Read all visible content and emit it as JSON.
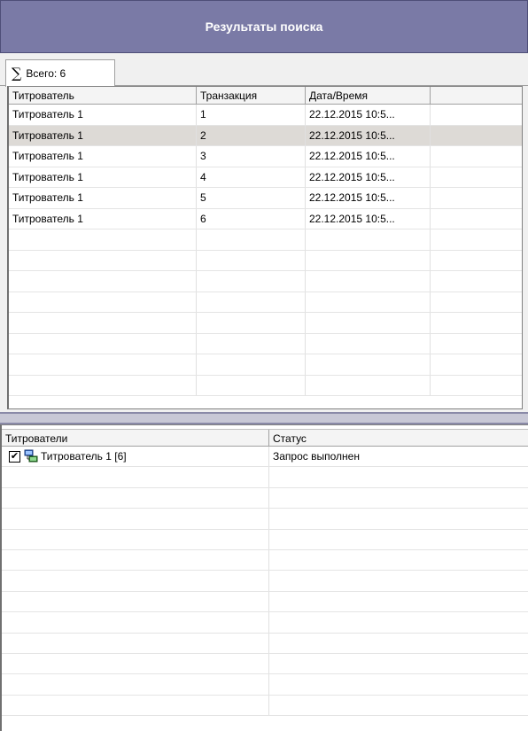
{
  "window": {
    "title": "Результаты поиска"
  },
  "tab": {
    "label": "Всего: 6",
    "icon": "sigma-icon"
  },
  "results_table": {
    "columns": [
      "Титрователь",
      "Транзакция",
      "Дата/Время",
      ""
    ],
    "rows": [
      [
        "Титрователь 1",
        "1",
        "22.12.2015 10:5...",
        ""
      ],
      [
        "Титрователь 1",
        "2",
        "22.12.2015 10:5...",
        ""
      ],
      [
        "Титрователь 1",
        "3",
        "22.12.2015 10:5...",
        ""
      ],
      [
        "Титрователь 1",
        "4",
        "22.12.2015 10:5...",
        ""
      ],
      [
        "Титрователь 1",
        "5",
        "22.12.2015 10:5...",
        ""
      ],
      [
        "Титрователь 1",
        "6",
        "22.12.2015 10:5...",
        ""
      ]
    ],
    "selected_row": 2
  },
  "status_table": {
    "columns": [
      "Титрователи",
      "Статус"
    ],
    "rows": [
      {
        "name": "Титрователь 1 [6]",
        "status": "Запрос выполнен",
        "checked": true,
        "icon": "titrator-device-icon"
      }
    ]
  },
  "colors": {
    "title_bg": "#7a7aa6",
    "selected_row": "#dddad6"
  }
}
